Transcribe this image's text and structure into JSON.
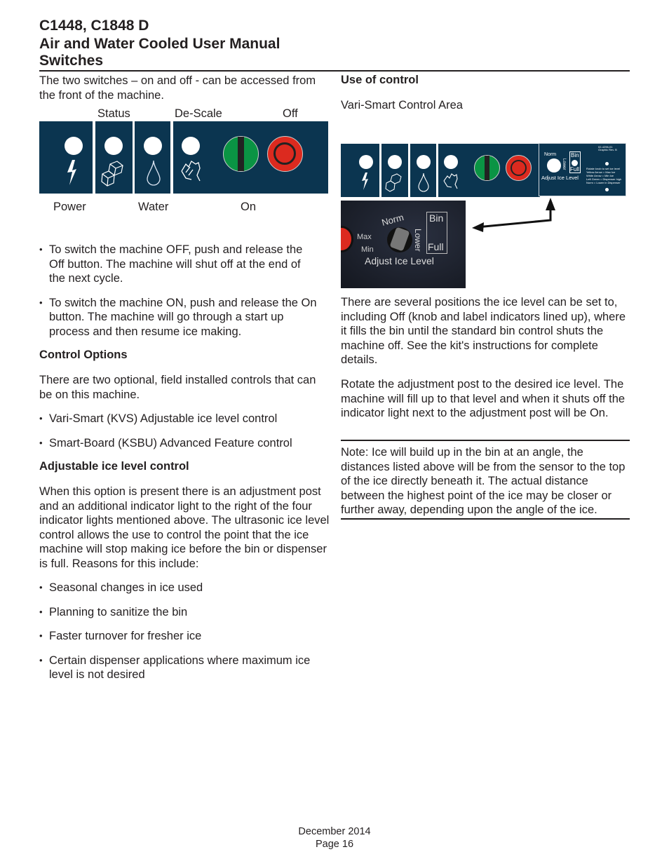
{
  "header": {
    "line1": "C1448, C1848 D",
    "line2": "Air and Water Cooled User Manual",
    "line3": "Switches"
  },
  "left": {
    "intro": "The two switches – on and off - can be accessed from the front of the machine.",
    "panel_labels": {
      "status": "Status",
      "descale": "De-Scale",
      "off": "Off",
      "power": "Power",
      "water": "Water",
      "on": "On"
    },
    "bullets1": [
      "To switch the machine OFF, push and release the Off button. The machine will shut off at the end of the next cycle.",
      "To switch the machine ON, push and release the On button. The machine will go through a start up process and then resume ice making."
    ],
    "control_options_heading": "Control Options",
    "control_options_text": "There are two optional, field installed controls that can be on this machine.",
    "bullets2": [
      "Vari-Smart (KVS) Adjustable ice level control",
      "Smart-Board (KSBU) Advanced Feature control"
    ],
    "adjustable_heading": "Adjustable ice level control",
    "adjustable_text": "When this option is present there is an adjustment post and an additional indicator light to the right of the four indicator lights mentioned above. The ultrasonic ice level control allows the use to control the point that the ice machine will stop making ice before the bin or dispenser is full. Reasons for this include:",
    "bullets3": [
      "Seasonal changes in ice used",
      "Planning to sanitize the bin",
      "Faster turnover for fresher ice",
      "Certain dispenser applications where maximum ice level is not desired"
    ]
  },
  "right": {
    "heading": "Use of control",
    "area_label": "Vari-Smart Control Area",
    "panel": {
      "norm": "Norm",
      "lower": "Lower",
      "bin": "Bin",
      "full": "Full",
      "adjust": "Adjust Ice Level",
      "max": "Max",
      "min": "Min",
      "part": "02-4296-01",
      "rev": "Graphic Rev. B",
      "legend": [
        "Rotate knob to set ice level",
        "Yellow Arrow = Max Ice",
        "White Arrow = Min Ice",
        "Left Green = Dispenser high",
        "Norm = Lower in Dispenser"
      ]
    },
    "p1": "There are several positions the ice level can be set to, including Off (knob and label indicators lined up), where it fills the bin until the standard bin control shuts the machine off. See the kit's instructions for complete details.",
    "p2": "Rotate the adjustment post to the desired ice level. The machine will fill up to that level and when it shuts off the indicator light next to the adjustment post will be On.",
    "note": "Note: Ice will build up in the bin at an angle, the distances listed above will be from the sensor to the top of the ice directly beneath it. The actual distance between the highest point of the ice may be closer or further away, depending upon the angle of the ice."
  },
  "footer": {
    "date": "December 2014",
    "page": "Page 16"
  },
  "colors": {
    "panel": "#0b3550",
    "on_green": "#0a9444",
    "off_red": "#dc2a1f"
  }
}
